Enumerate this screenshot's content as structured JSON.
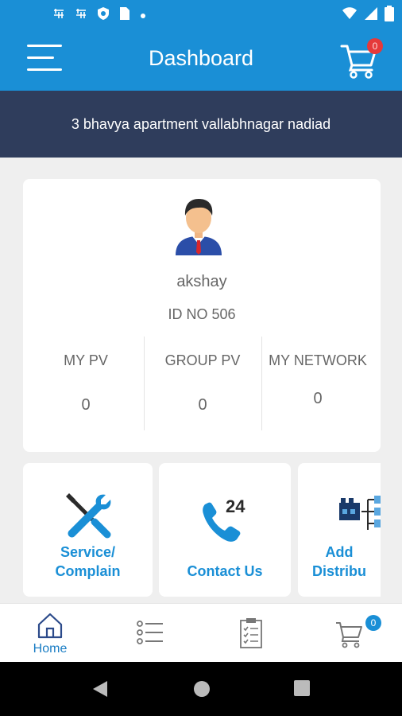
{
  "status_bar": {
    "left_icons": [
      "notification-icon",
      "notification-icon",
      "shield-icon",
      "sim-icon",
      "dot-icon"
    ],
    "right_icons": [
      "wifi-icon",
      "signal-icon",
      "battery-icon"
    ]
  },
  "app_bar": {
    "title": "Dashboard",
    "cart_count": "0"
  },
  "address": "3 bhavya apartment vallabhnagar nadiad",
  "profile": {
    "name": "akshay",
    "id_text": "ID NO 506",
    "stats": [
      {
        "label": "MY PV",
        "value": "0"
      },
      {
        "label": "GROUP PV",
        "value": "0"
      },
      {
        "label": "MY NETWORK",
        "value": "0"
      }
    ]
  },
  "tiles": [
    {
      "label_line1": "Service/",
      "label_line2": "Complain",
      "icon": "tools-icon"
    },
    {
      "label_line1": "Contact Us",
      "icon": "phone-24-icon",
      "icon_text": "24"
    },
    {
      "label_line1": "Add",
      "label_line2": "Distribu",
      "icon": "distributor-network-icon"
    }
  ],
  "bottom_nav": {
    "items": [
      {
        "label": "Home",
        "icon": "home-icon"
      },
      {
        "icon": "list-icon"
      },
      {
        "icon": "clipboard-icon"
      },
      {
        "icon": "cart-icon",
        "badge": "0"
      }
    ]
  },
  "colors": {
    "primary": "#1a8fd6",
    "address_bg": "#2f3d5c",
    "badge_red": "#e5393a"
  }
}
